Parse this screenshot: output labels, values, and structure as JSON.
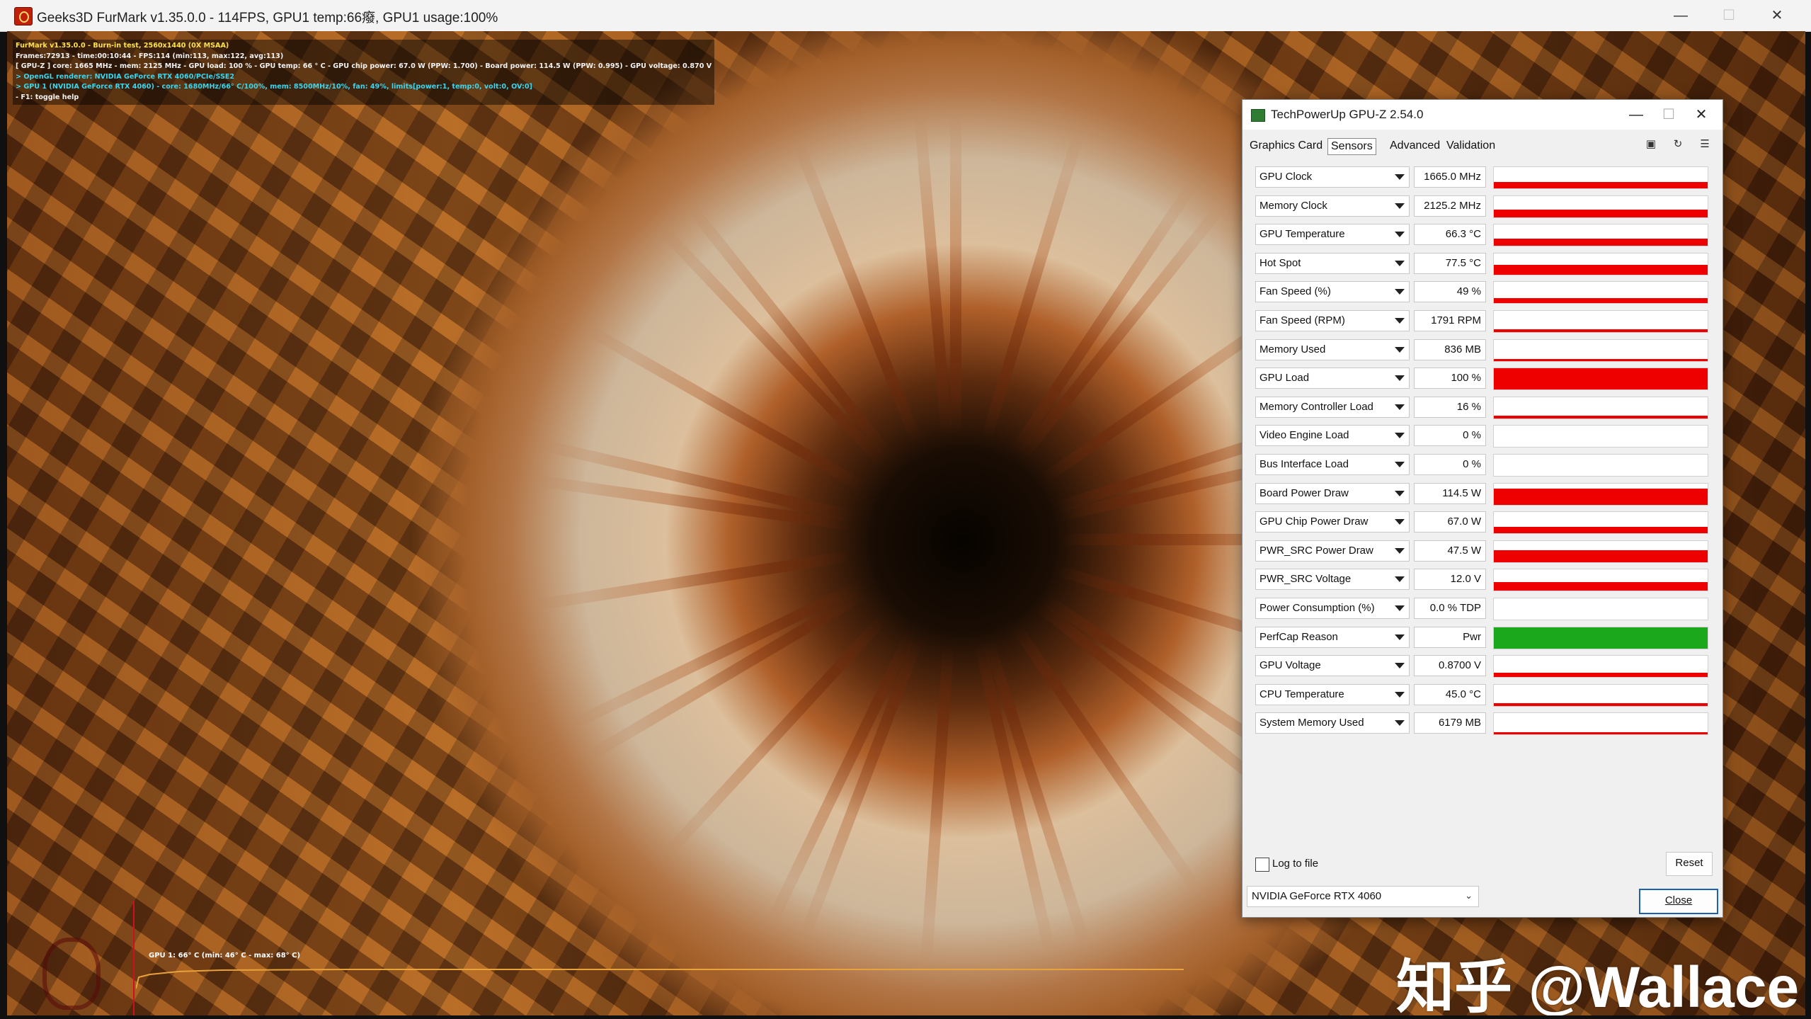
{
  "furmark": {
    "title": "Geeks3D FurMark v1.35.0.0 - 114FPS, GPU1 temp:66癈, GPU1 usage:100%",
    "overlay": [
      {
        "text": "FurMark v1.35.0.0 - Burn-in test, 2560x1440 (0X MSAA)",
        "color": "yellow"
      },
      {
        "text": "Frames:72913 - time:00:10:44 - FPS:114 (min:113, max:122, avg:113)",
        "color": "white"
      },
      {
        "text": "[ GPU-Z ] core: 1665 MHz - mem: 2125 MHz - GPU load: 100 % - GPU temp: 66 ° C - GPU chip power: 67.0 W (PPW: 1.700) - Board power: 114.5 W (PPW: 0.995) - GPU voltage: 0.870 V",
        "color": "white"
      },
      {
        "text": "> OpenGL renderer: NVIDIA GeForce RTX 4060/PCIe/SSE2",
        "color": "cyan"
      },
      {
        "text": "> GPU 1 (NVIDIA GeForce RTX 4060) - core: 1680MHz/66° C/100%, mem: 8500MHz/10%, fan: 49%, limits[power:1, temp:0, volt:0, OV:0]",
        "color": "cyan"
      },
      {
        "text": "- F1: toggle help",
        "color": "white"
      }
    ],
    "graph_label": "GPU 1: 66° C (min: 46° C - max: 68° C)",
    "window_buttons": {
      "minimize": "—",
      "maximize": "☐",
      "close": "✕"
    }
  },
  "watermark": "知乎 @Wallace",
  "gpuz": {
    "title": "TechPowerUp GPU-Z 2.54.0",
    "window_buttons": {
      "minimize": "—",
      "maximize": "☐",
      "close": "✕"
    },
    "tabs": [
      "Graphics Card",
      "Sensors",
      "Advanced",
      "Validation"
    ],
    "active_tab": "Sensors",
    "sensors": [
      {
        "name": "GPU Clock",
        "value": "1665.0 MHz",
        "level": 0.3,
        "color": "#ee0000"
      },
      {
        "name": "Memory Clock",
        "value": "2125.2 MHz",
        "level": 0.35,
        "color": "#ee0000"
      },
      {
        "name": "GPU Temperature",
        "value": "66.3 °C",
        "level": 0.35,
        "color": "#ee0000"
      },
      {
        "name": "Hot Spot",
        "value": "77.5 °C",
        "level": 0.45,
        "color": "#ee0000"
      },
      {
        "name": "Fan Speed (%)",
        "value": "49 %",
        "level": 0.25,
        "color": "#ee0000"
      },
      {
        "name": "Fan Speed (RPM)",
        "value": "1791 RPM",
        "level": 0.15,
        "color": "#ee0000"
      },
      {
        "name": "Memory Used",
        "value": "836 MB",
        "level": 0.08,
        "color": "#ee0000"
      },
      {
        "name": "GPU Load",
        "value": "100 %",
        "level": 1.0,
        "color": "#ee0000"
      },
      {
        "name": "Memory Controller Load",
        "value": "16 %",
        "level": 0.12,
        "color": "#ee0000"
      },
      {
        "name": "Video Engine Load",
        "value": "0 %",
        "level": 0.0,
        "color": "#ee0000"
      },
      {
        "name": "Bus Interface Load",
        "value": "0 %",
        "level": 0.0,
        "color": "#ee0000"
      },
      {
        "name": "Board Power Draw",
        "value": "114.5 W",
        "level": 0.75,
        "color": "#ee0000"
      },
      {
        "name": "GPU Chip Power Draw",
        "value": "67.0 W",
        "level": 0.3,
        "color": "#ee0000"
      },
      {
        "name": "PWR_SRC Power Draw",
        "value": "47.5 W",
        "level": 0.55,
        "color": "#ee0000"
      },
      {
        "name": "PWR_SRC Voltage",
        "value": "12.0 V",
        "level": 0.4,
        "color": "#ee0000"
      },
      {
        "name": "Power Consumption (%)",
        "value": "0.0 % TDP",
        "level": 0.0,
        "color": "#ee0000"
      },
      {
        "name": "PerfCap Reason",
        "value": "Pwr",
        "level": 1.0,
        "color": "#1ca81c"
      },
      {
        "name": "GPU Voltage",
        "value": "0.8700 V",
        "level": 0.2,
        "color": "#ee0000"
      },
      {
        "name": "CPU Temperature",
        "value": "45.0 °C",
        "level": 0.12,
        "color": "#ee0000"
      },
      {
        "name": "System Memory Used",
        "value": "6179 MB",
        "level": 0.1,
        "color": "#ee0000"
      }
    ],
    "log_to_file_label": "Log to file",
    "reset_label": "Reset",
    "device_select": "NVIDIA GeForce RTX 4060",
    "close_label": "Close"
  }
}
